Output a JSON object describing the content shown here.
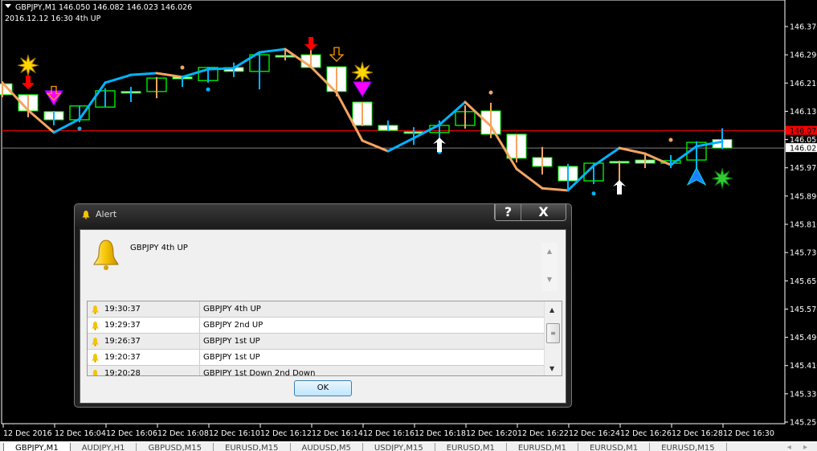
{
  "header": {
    "line1": "GBPJPY,M1  146.050 146.082 146.023 146.026",
    "line2": "2016.12.12 16:30  4th UP"
  },
  "colors": {
    "background": "#000000",
    "bear_body": "#ffffff",
    "bull_outline": "#00ff00",
    "line_up": "#00b4ff",
    "line_down": "#f4a460",
    "bid_line": "#ff0000",
    "last_line": "#808080"
  },
  "chart_data": {
    "type": "candlestick",
    "symbol": "GBPJPY",
    "timeframe": "M1",
    "ylim": [
      145.25,
      146.37
    ],
    "price_ticks": [
      "146.370",
      "146.290",
      "146.210",
      "146.130",
      "146.050",
      "145.970",
      "145.890",
      "145.810",
      "145.730",
      "145.650",
      "145.570",
      "145.490",
      "145.410",
      "145.330",
      "145.250"
    ],
    "bid_price": "146.075",
    "last_price": "146.026",
    "time_labels": [
      "12 Dec 2016",
      "12 Dec 16:04",
      "12 Dec 16:06",
      "12 Dec 16:08",
      "12 Dec 16:10",
      "12 Dec 16:12",
      "12 Dec 16:14",
      "12 Dec 16:16",
      "12 Dec 16:18",
      "12 Dec 16:20",
      "12 Dec 16:22",
      "12 Dec 16:24",
      "12 Dec 16:26",
      "12 Dec 16:28",
      "12 Dec 16:30"
    ],
    "candles": [
      [
        146.208,
        146.215,
        146.17,
        146.177
      ],
      [
        146.177,
        146.177,
        146.113,
        146.131
      ],
      [
        146.129,
        146.131,
        146.09,
        146.106
      ],
      [
        146.106,
        146.147,
        146.099,
        146.145
      ],
      [
        146.142,
        146.195,
        146.142,
        146.188
      ],
      [
        146.186,
        146.199,
        146.156,
        146.186
      ],
      [
        146.186,
        146.227,
        146.167,
        146.224
      ],
      [
        146.227,
        146.231,
        146.199,
        146.222
      ],
      [
        146.217,
        146.256,
        146.211,
        146.254
      ],
      [
        146.254,
        146.268,
        146.227,
        146.243
      ],
      [
        146.243,
        146.297,
        146.192,
        146.29
      ],
      [
        146.288,
        146.306,
        146.274,
        146.286
      ],
      [
        146.29,
        146.304,
        146.252,
        146.254
      ],
      [
        146.256,
        146.256,
        146.172,
        146.186
      ],
      [
        146.156,
        146.156,
        146.088,
        146.09
      ],
      [
        146.09,
        146.104,
        146.074,
        146.076
      ],
      [
        146.072,
        146.085,
        146.035,
        146.072
      ],
      [
        146.07,
        146.104,
        146.024,
        146.09
      ],
      [
        146.09,
        146.147,
        146.081,
        146.129
      ],
      [
        146.131,
        146.154,
        146.054,
        146.065
      ],
      [
        146.065,
        146.065,
        145.985,
        145.997
      ],
      [
        145.999,
        146.029,
        145.951,
        145.974
      ],
      [
        145.974,
        145.981,
        145.91,
        145.933
      ],
      [
        145.933,
        145.983,
        145.924,
        145.983
      ],
      [
        145.988,
        145.99,
        145.899,
        145.988
      ],
      [
        145.992,
        146.013,
        145.969,
        145.983
      ],
      [
        145.983,
        146.006,
        145.969,
        145.99
      ],
      [
        145.992,
        146.045,
        145.967,
        146.042
      ],
      [
        146.05,
        146.082,
        146.023,
        146.026
      ]
    ],
    "trend_line": [
      146.211,
      146.133,
      146.07,
      146.108,
      146.211,
      146.233,
      146.238,
      146.227,
      146.249,
      146.252,
      146.297,
      146.306,
      146.256,
      146.183,
      146.047,
      146.017,
      146.054,
      146.092,
      146.156,
      146.088,
      145.967,
      145.912,
      145.906,
      145.976,
      146.026,
      146.01,
      145.978,
      146.031,
      146.044
    ],
    "trend_direction": [
      "down",
      "down",
      "up",
      "up",
      "up",
      "up",
      "down",
      "up",
      "up",
      "up",
      "up",
      "down",
      "down",
      "down",
      "down",
      "up",
      "up",
      "up",
      "down",
      "down",
      "down",
      "down",
      "up",
      "up",
      "down",
      "down",
      "up",
      "up"
    ],
    "dots": [
      {
        "bar": 3,
        "price": 146.081,
        "color": "#00b4ff"
      },
      {
        "bar": 7,
        "price": 146.254,
        "color": "#f4a460"
      },
      {
        "bar": 8,
        "price": 146.192,
        "color": "#00b4ff"
      },
      {
        "bar": 17,
        "price": 146.015,
        "color": "#00b4ff"
      },
      {
        "bar": 19,
        "price": 146.183,
        "color": "#f4a460"
      },
      {
        "bar": 23,
        "price": 145.897,
        "color": "#00b4ff"
      },
      {
        "bar": 26,
        "price": 146.049,
        "color": "#f4a460"
      }
    ],
    "signals": [
      {
        "bar": 1,
        "price": 146.26,
        "icon": "gold-star"
      },
      {
        "bar": 1,
        "price": 146.21,
        "icon": "red-down-arrow"
      },
      {
        "bar": 2,
        "price": 146.17,
        "icon": "magenta-down-triangle"
      },
      {
        "bar": 2,
        "price": 146.18,
        "icon": "orange-down-arrow"
      },
      {
        "bar": 12,
        "price": 146.32,
        "icon": "red-down-arrow"
      },
      {
        "bar": 13,
        "price": 146.29,
        "icon": "orange-down-arrow"
      },
      {
        "bar": 14,
        "price": 146.24,
        "icon": "gold-star"
      },
      {
        "bar": 14,
        "price": 146.195,
        "icon": "magenta-down-triangle"
      },
      {
        "bar": 17,
        "price": 146.035,
        "icon": "white-up-arrow"
      },
      {
        "bar": 24,
        "price": 145.915,
        "icon": "white-up-arrow"
      },
      {
        "bar": 27,
        "price": 145.945,
        "icon": "blue-up-arrow"
      },
      {
        "bar": 28,
        "price": 145.94,
        "icon": "green-star"
      }
    ]
  },
  "alert": {
    "title": "Alert",
    "help": "?",
    "close": "X",
    "message": "GBPJPY  4th UP",
    "rows": [
      {
        "time": "19:30:37",
        "text": "GBPJPY  4th UP"
      },
      {
        "time": "19:29:37",
        "text": "GBPJPY  2nd UP"
      },
      {
        "time": "19:26:37",
        "text": "GBPJPY  1st UP"
      },
      {
        "time": "19:20:37",
        "text": "GBPJPY  1st UP"
      },
      {
        "time": "19:20:28",
        "text": "GBPJPY  1st Down 2nd Down"
      }
    ],
    "ok": "OK"
  },
  "tabs": [
    "GBPJPY,M1",
    "AUDJPY,H1",
    "GBPUSD,M15",
    "EURUSD,M15",
    "AUDUSD,M5",
    "USDJPY,M15",
    "EURUSD,M1",
    "EURUSD,M1",
    "EURUSD,M1",
    "EURUSD,M15"
  ],
  "tab_nav": "◂ ▸"
}
